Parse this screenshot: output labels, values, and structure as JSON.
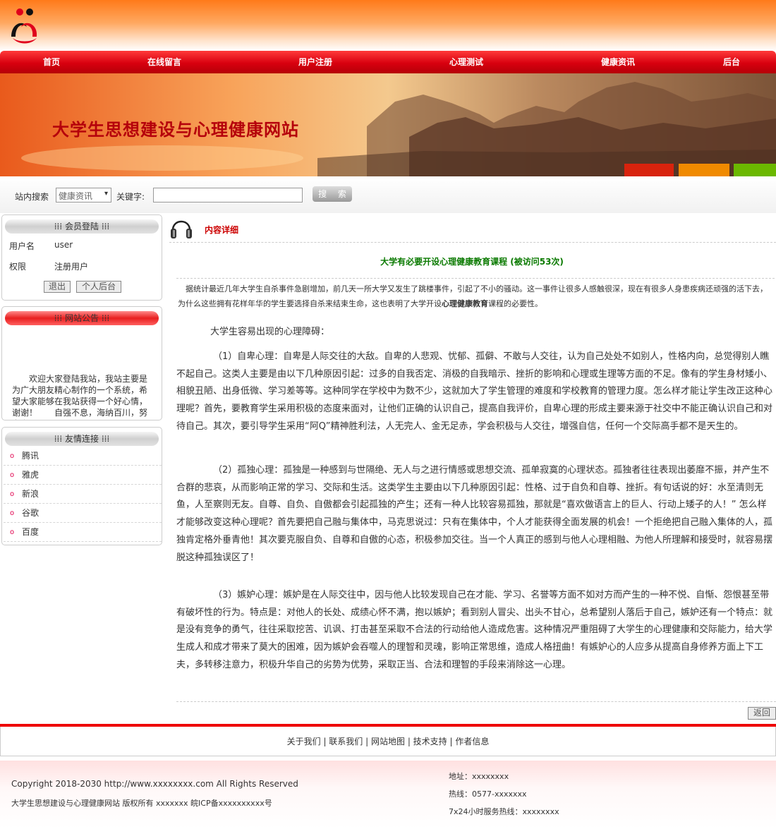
{
  "nav": [
    "首页",
    "在线留言",
    "用户注册",
    "心理测试",
    "健康资讯",
    "后台"
  ],
  "banner_title": "大学生思想建设与心理健康网站",
  "search": {
    "label": "站内搜索",
    "category": "健康资讯",
    "keyword_label": "关键字:",
    "button": "搜 索"
  },
  "member": {
    "title": "会员登陆",
    "username_label": "用户名",
    "username": "user",
    "role_label": "权限",
    "role": "注册用户",
    "logout": "退出",
    "personal": "个人后台"
  },
  "announcement": {
    "title": "网站公告",
    "text": "欢迎大家登陆我站，我站主要是为广大朋友精心制作的一个系统，希望大家能够在我站获得一个好心情，谢谢！　　自强不息，海纳百川，努力学"
  },
  "links": {
    "title": "友情连接",
    "items": [
      "腾讯",
      "雅虎",
      "新浪",
      "谷歌",
      "百度"
    ]
  },
  "content": {
    "header": "内容详细",
    "article_title": "大学有必要开设心理健康教育课程 (被访问53次)",
    "intro_a": "据统计最近几年大学生自杀事件急剧增加，前几天一所大学又发生了跳楼事件，引起了不小的骚动。这一事件让很多人感触很深，现在有很多人身患疾病还顽强的活下去，为什么这些拥有花样年华的学生要选择自杀来结束生命，这也表明了大学开设",
    "intro_b": "心理健康教育",
    "intro_c": "课程的必要性。",
    "subhead": "大学生容易出现的心理障碍：",
    "p1": "（1）自卑心理：自卑是人际交往的大敌。自卑的人悲观、忧郁、孤僻、不敢与人交往，认为自己处处不如别人，性格内向，总觉得别人瞧不起自己。这类人主要是由以下几种原因引起：过多的自我否定、消极的自我暗示、挫折的影响和心理或生理等方面的不足。像有的学生身材矮小、相貌丑陋、出身低微、学习差等等。这种同学在学校中为数不少，这就加大了学生管理的难度和学校教育的管理力度。怎么样才能让学生改正这种心理呢？首先，要教育学生采用积极的态度来面对，让他们正确的认识自己，提高自我评价，自卑心理的形成主要来源于社交中不能正确认识自己和对待自己。其次，要引导学生采用“阿Q”精神胜利法，人无完人、金无足赤，学会积极与人交往，增强自信，任何一个交际高手都不是天生的。",
    "p2": "（2）孤独心理：孤独是一种感到与世隔绝、无人与之进行情感或思想交流、孤单寂寞的心理状态。孤独者往往表现出萎靡不振，并产生不合群的悲哀，从而影响正常的学习、交际和生活。这类学生主要由以下几种原因引起：性格、过于自负和自尊、挫折。有句话说的好：水至清则无鱼，人至察则无友。自尊、自负、自傲都会引起孤独的产生；还有一种人比较容易孤独，那就是“喜欢做语言上的巨人、行动上矮子的人！” 怎么样才能够改变这种心理呢？首先要把自己融与集体中，马克思说过：只有在集体中，个人才能获得全面发展的机会！一个拒绝把自己融入集体的人，孤独肯定格外垂青他！其次要克服自负、自尊和自傲的心态，积极参加交往。当一个人真正的感到与他人心理相融、为他人所理解和接受时，就容易摆脱这种孤独误区了！",
    "p3": "（3）嫉妒心理：嫉妒是在人际交往中，因与他人比较发现自己在才能、学习、名誉等方面不如对方而产生的一种不悦、自惭、怨恨甚至带有破坏性的行为。特点是：对他人的长处、成绩心怀不满，抱以嫉妒；看到别人冒尖、出头不甘心，总希望别人落后于自己，嫉妒还有一个特点：就是没有竞争的勇气，往往采取挖苦、讥讽、打击甚至采取不合法的行动给他人造成危害。这种情况严重阻碍了大学生的心理健康和交际能力，给大学生成人和成才带来了莫大的困难，因为嫉妒会吞噬人的理智和灵魂，影响正常思维，造成人格扭曲！有嫉妒心的人应多从提高自身修养方面上下工夫，多转移注意力，积极升华自己的劣势为优势，采取正当、合法和理智的手段来消除这一心理。",
    "back": "返回"
  },
  "footer": {
    "links": [
      "关于我们",
      "联系我们",
      "网站地图",
      "技术支持",
      "作者信息"
    ],
    "copyright": "Copyright 2018-2030 http://www.xxxxxxxx.com All Rights Reserved",
    "icp": "大学生思想建设与心理健康网站 版权所有 xxxxxxx 皖ICP备xxxxxxxxxx号",
    "address": "地址：xxxxxxxx",
    "hotline": "热线：0577-xxxxxxx",
    "service": "7x24小时服务热线：xxxxxxxx"
  },
  "colors": {
    "nav_red": "#d8000f",
    "title_red": "#b5000b",
    "article_green": "#0a7a00",
    "accent_pink": "#e0004d"
  }
}
